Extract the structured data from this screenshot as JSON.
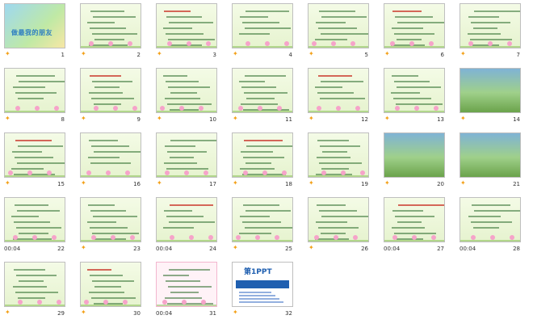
{
  "slides": [
    {
      "n": "1",
      "title": "做最我的朋友",
      "timer": ""
    },
    {
      "n": "2",
      "timer": ""
    },
    {
      "n": "3",
      "timer": ""
    },
    {
      "n": "4",
      "timer": ""
    },
    {
      "n": "5",
      "timer": ""
    },
    {
      "n": "6",
      "timer": ""
    },
    {
      "n": "7",
      "timer": ""
    },
    {
      "n": "8",
      "timer": ""
    },
    {
      "n": "9",
      "timer": ""
    },
    {
      "n": "10",
      "timer": ""
    },
    {
      "n": "11",
      "timer": ""
    },
    {
      "n": "12",
      "timer": ""
    },
    {
      "n": "13",
      "timer": ""
    },
    {
      "n": "14",
      "timer": ""
    },
    {
      "n": "15",
      "timer": ""
    },
    {
      "n": "16",
      "timer": ""
    },
    {
      "n": "17",
      "timer": ""
    },
    {
      "n": "18",
      "timer": ""
    },
    {
      "n": "19",
      "timer": ""
    },
    {
      "n": "20",
      "timer": ""
    },
    {
      "n": "21",
      "timer": ""
    },
    {
      "n": "22",
      "timer": "00:04"
    },
    {
      "n": "23",
      "timer": ""
    },
    {
      "n": "24",
      "timer": "00:04"
    },
    {
      "n": "25",
      "timer": ""
    },
    {
      "n": "26",
      "timer": ""
    },
    {
      "n": "27",
      "timer": "00:04"
    },
    {
      "n": "28",
      "timer": "00:04"
    },
    {
      "n": "29",
      "timer": ""
    },
    {
      "n": "30",
      "timer": ""
    },
    {
      "n": "31",
      "timer": "00:04"
    },
    {
      "n": "32",
      "timer": ""
    }
  ],
  "slide32_logo": "第1PPT"
}
